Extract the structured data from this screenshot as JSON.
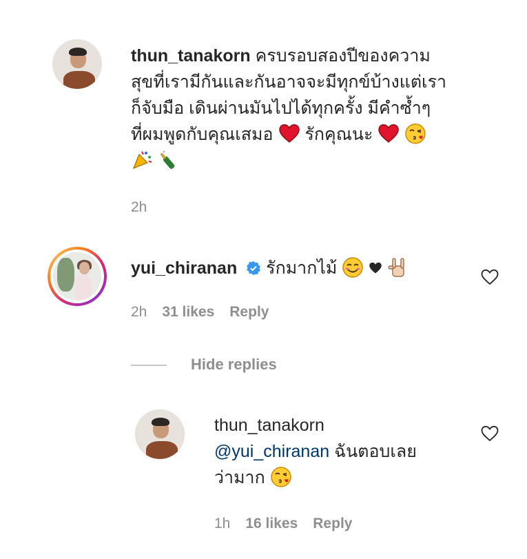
{
  "comments": [
    {
      "username": "thun_tanakorn",
      "text_line1": "ครบรอบสองปีของความ",
      "text_line2": "สุขที่เรามีกันและกันอาจจะมีทุกข์บ้างแต่เรา",
      "text_line3": "ก็จับมือ เดินผ่านมันไปได้ทุกครั้ง มีคำซ้ำๆ",
      "text_line4a": "ที่ผมพูดกับคุณเสมอ",
      "text_line4b": "รักคุณนะ",
      "time": "2h"
    },
    {
      "username": "yui_chiranan",
      "text": "รักมากไม้",
      "time": "2h",
      "likes": "31 likes",
      "reply": "Reply"
    }
  ],
  "hide_replies": "Hide replies",
  "reply": {
    "username": "thun_tanakorn",
    "mention": "@yui_chiranan",
    "text_line1": "ฉันตอบเลย",
    "text_line2": "ว่ามาก",
    "time": "1h",
    "likes": "16 likes",
    "reply": "Reply"
  },
  "icons": {
    "heart": "heart-outline-icon",
    "verified": "verified-badge-icon"
  },
  "colors": {
    "mention": "#00376b",
    "verified": "#3897f0",
    "meta": "#8e8e8e"
  }
}
